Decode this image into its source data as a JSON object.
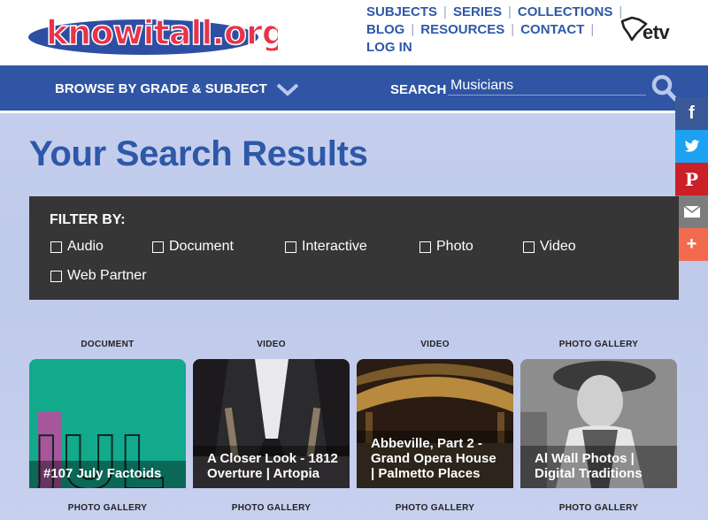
{
  "header": {
    "logo_text": "knowitall.org",
    "nav_row1": [
      "SUBJECTS",
      "SERIES",
      "COLLECTIONS"
    ],
    "nav_row2": [
      "BLOG",
      "RESOURCES",
      "CONTACT"
    ],
    "nav_row3": [
      "LOG IN"
    ],
    "etv_text": "etv"
  },
  "navbar": {
    "browse_label": "BROWSE BY GRADE & SUBJECT",
    "search_label": "SEARCH",
    "search_value": "Musicians"
  },
  "share": {
    "facebook": "f",
    "twitter": "twitter-icon",
    "pinterest": "P",
    "email": "email-icon",
    "more": "+"
  },
  "page_title": "Your Search Results",
  "filter": {
    "title": "FILTER BY:",
    "options": [
      "Audio",
      "Document",
      "Interactive",
      "Photo",
      "Video",
      "Web Partner"
    ]
  },
  "results": [
    {
      "type": "DOCUMENT",
      "title": "#107 July Factoids",
      "art_text": "JUL"
    },
    {
      "type": "VIDEO",
      "title": "A Closer Look - 1812 Overture | Artopia"
    },
    {
      "type": "VIDEO",
      "title": "Abbeville, Part 2 - Grand Opera House | Palmetto Places"
    },
    {
      "type": "PHOTO GALLERY",
      "title": "Al Wall Photos | Digital Traditions"
    }
  ],
  "next_row_types": [
    "PHOTO GALLERY",
    "PHOTO GALLERY",
    "PHOTO GALLERY",
    "PHOTO GALLERY"
  ],
  "colors": {
    "brand_blue": "#2f55a4",
    "filter_bg": "#363636",
    "facebook": "#3b5998",
    "twitter": "#1da1f2",
    "pinterest": "#cb2027",
    "email": "#7d7d7d",
    "more": "#f26b4f"
  }
}
